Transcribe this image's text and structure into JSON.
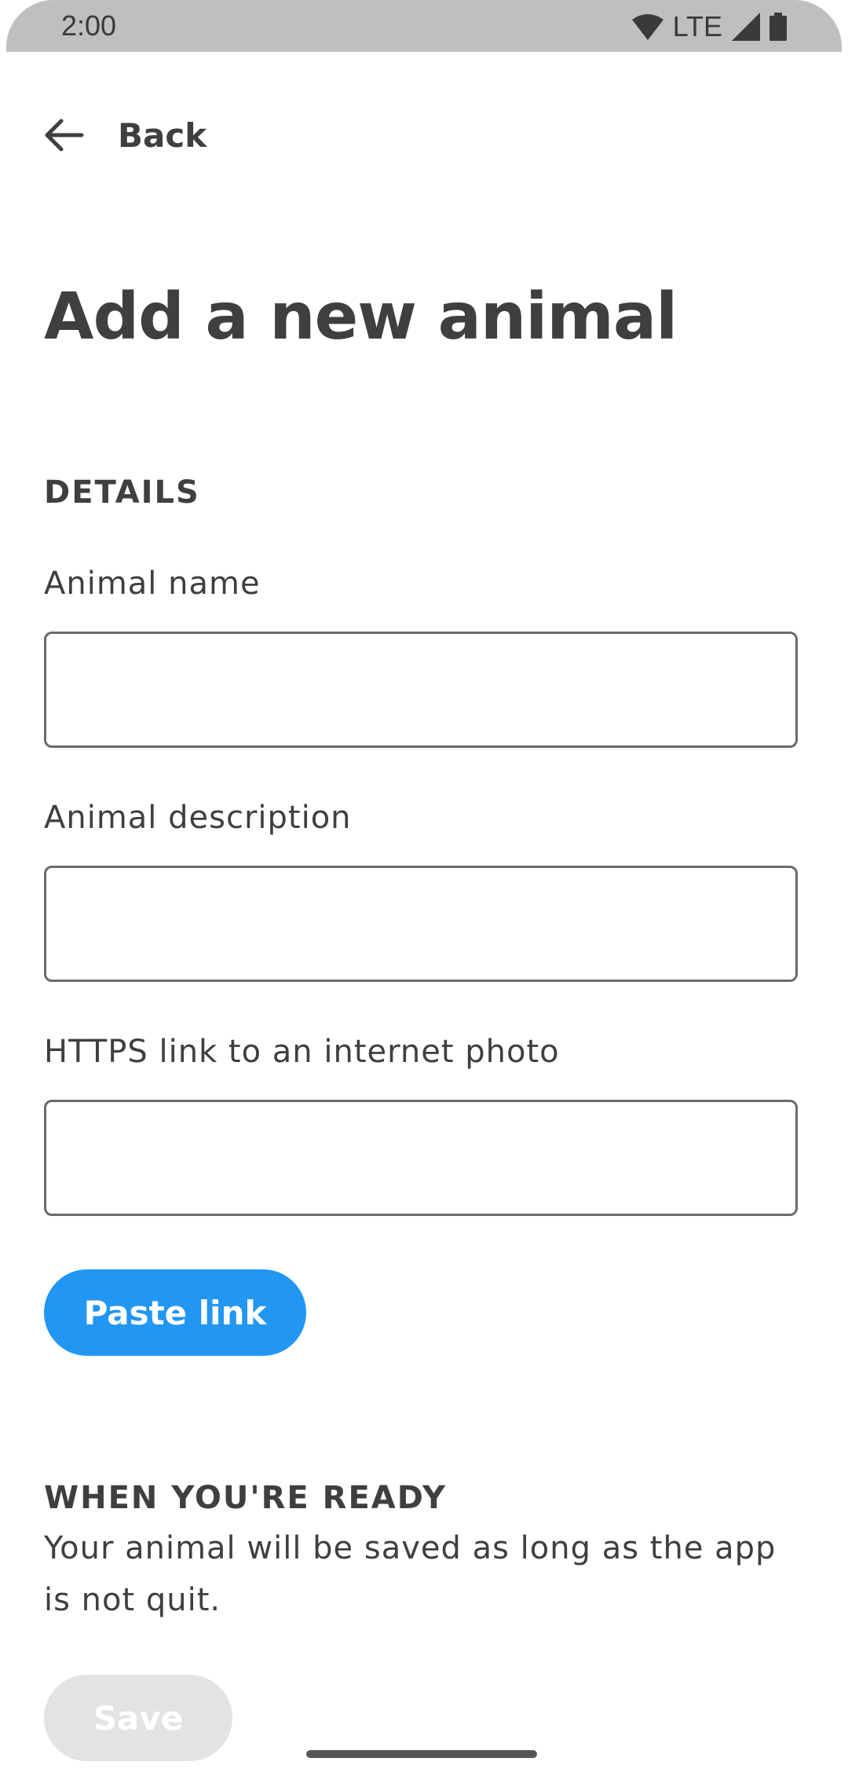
{
  "status_bar": {
    "time": "2:00",
    "network": "LTE",
    "icons": [
      "wifi-icon",
      "cell-signal-icon",
      "battery-icon"
    ]
  },
  "nav": {
    "back_label": "Back",
    "back_icon": "arrow-left-icon"
  },
  "page": {
    "title": "Add a new animal"
  },
  "details": {
    "header": "DETAILS",
    "fields": [
      {
        "label": "Animal name",
        "value": "",
        "placeholder": ""
      },
      {
        "label": "Animal description",
        "value": "",
        "placeholder": ""
      },
      {
        "label": "HTTPS link to an internet photo",
        "value": "",
        "placeholder": ""
      }
    ],
    "paste_label": "Paste link"
  },
  "ready": {
    "header": "WHEN YOU'RE READY",
    "body": "Your animal will be saved as long as the app is not quit.",
    "save_label": "Save"
  },
  "colors": {
    "accent": "#2196f3",
    "disabled_button": "#e3e3e3",
    "text": "#3f3f3f",
    "status_bar": "#bfbfbf"
  }
}
